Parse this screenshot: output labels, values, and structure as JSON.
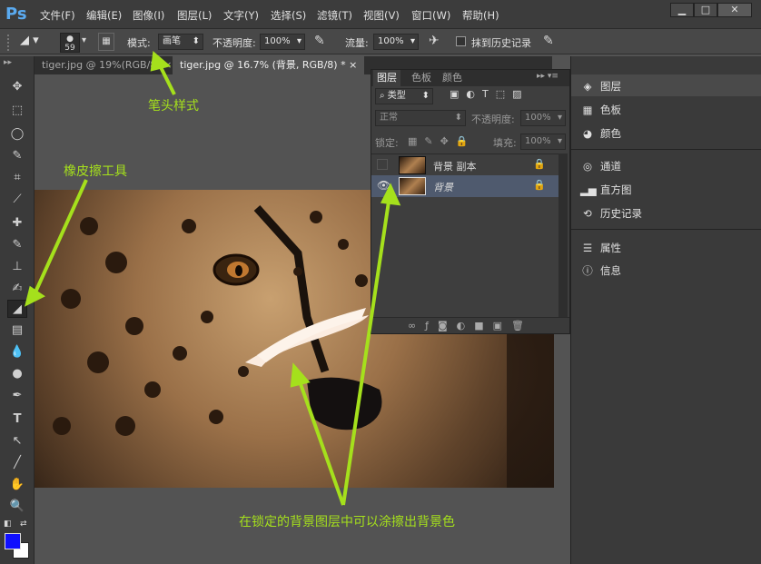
{
  "app": {
    "logo": "Ps"
  },
  "menu": [
    "文件(F)",
    "编辑(E)",
    "图像(I)",
    "图层(L)",
    "文字(Y)",
    "选择(S)",
    "滤镜(T)",
    "视图(V)",
    "窗口(W)",
    "帮助(H)"
  ],
  "window_buttons": [
    "▁",
    "□",
    "✕"
  ],
  "options": {
    "brush_size": "59",
    "mode_label": "模式:",
    "mode_value": "画笔",
    "opacity_label": "不透明度:",
    "opacity_value": "100%",
    "flow_label": "流量:",
    "flow_value": "100%",
    "history_label": "抹到历史记录"
  },
  "tabs": [
    {
      "label": "tiger.jpg @ 19%(RGB/8)",
      "close": "×"
    },
    {
      "label": "tiger.jpg @ 16.7% (背景, RGB/8) *",
      "close": "×"
    }
  ],
  "layers_panel": {
    "tabs": [
      "图层",
      "色板",
      "颜色"
    ],
    "filter_kind": "类型",
    "blend_mode": "正常",
    "opacity_label": "不透明度:",
    "opacity_value": "100%",
    "lock_label": "锁定:",
    "fill_label": "填充:",
    "fill_value": "100%",
    "layers": [
      {
        "name": "背景 副本",
        "visible": false,
        "locked": true
      },
      {
        "name": "背景",
        "visible": true,
        "locked": true
      }
    ]
  },
  "right_panels": [
    {
      "label": "图层",
      "icon": "layers-icon"
    },
    {
      "label": "色板",
      "icon": "swatches-icon"
    },
    {
      "label": "颜色",
      "icon": "color-icon"
    },
    {
      "label": "通道",
      "icon": "channels-icon"
    },
    {
      "label": "直方图",
      "icon": "histogram-icon"
    },
    {
      "label": "历史记录",
      "icon": "history-icon"
    },
    {
      "label": "属性",
      "icon": "properties-icon"
    },
    {
      "label": "信息",
      "icon": "info-icon"
    }
  ],
  "annotations": {
    "brush_style": "笔头样式",
    "eraser_tool": "橡皮擦工具",
    "locked_bg": "在锁定的背景图层中可以涂擦出背景色"
  },
  "colors": {
    "foreground": "#1010ff",
    "background": "#ffffff",
    "annotation": "#a5e01c"
  }
}
